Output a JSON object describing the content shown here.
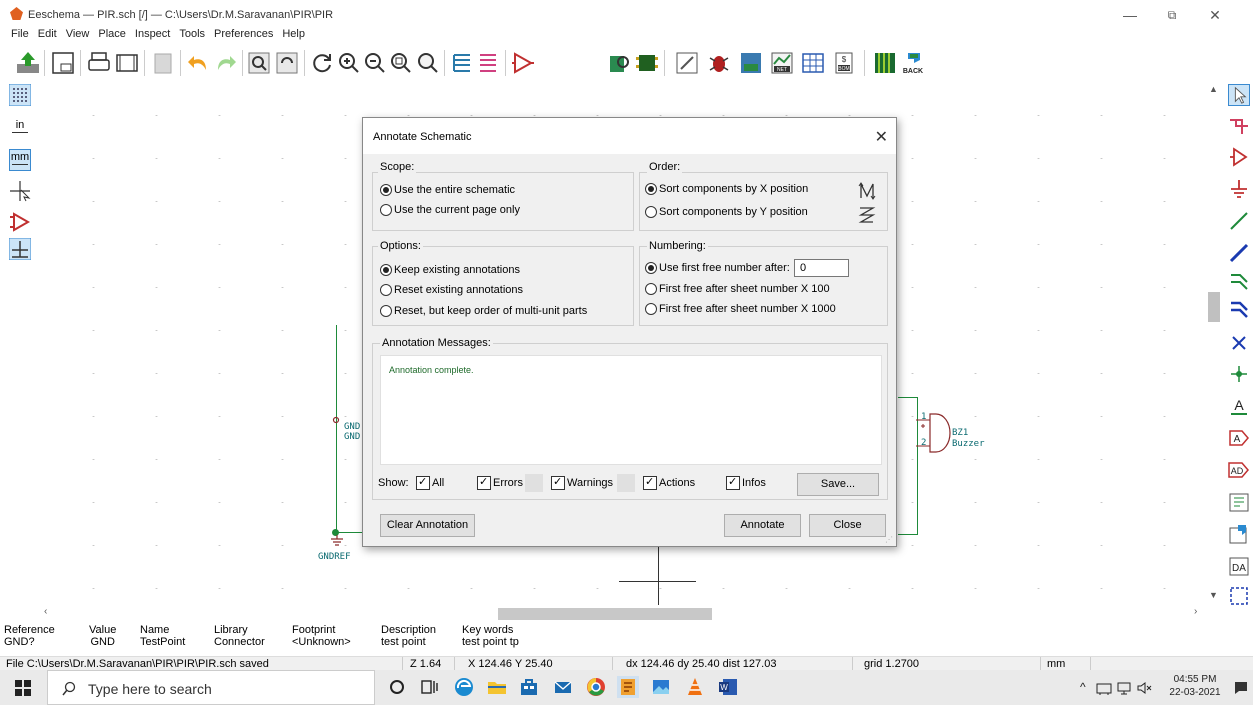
{
  "window": {
    "title": "Eeschema — PIR.sch [/] — C:\\Users\\Dr.M.Saravanan\\PIR\\PIR",
    "minimize": "—",
    "restore": "⧉",
    "close": "✕"
  },
  "menu": [
    "File",
    "Edit",
    "View",
    "Place",
    "Inspect",
    "Tools",
    "Preferences",
    "Help"
  ],
  "toolbar": {
    "back_label": "BACK",
    "net_label": "NET",
    "bom_label": "BOM"
  },
  "left_toolbar": {
    "units_in": "in",
    "units_mm": "mm"
  },
  "schematic": {
    "gnd_label_1": "GND",
    "gnd_label_2": "GND",
    "gndref_label": "GNDREF",
    "buzzer_ref": "BZ1",
    "buzzer_value": "Buzzer",
    "pin1": "1",
    "pin2": "2"
  },
  "dialog": {
    "title": "Annotate Schematic",
    "scope": {
      "label": "Scope:",
      "options": [
        "Use the entire schematic",
        "Use the current page only"
      ],
      "selected": 0
    },
    "order": {
      "label": "Order:",
      "options": [
        "Sort components by X position",
        "Sort components by Y position"
      ],
      "selected": 0
    },
    "options": {
      "label": "Options:",
      "options": [
        "Keep existing annotations",
        "Reset existing annotations",
        "Reset, but keep order of multi-unit parts"
      ],
      "selected": 0
    },
    "numbering": {
      "label": "Numbering:",
      "options": [
        "Use first free number after:",
        "First free after sheet number X 100",
        "First free after sheet number X 1000"
      ],
      "selected": 0,
      "first_free_value": "0"
    },
    "messages": {
      "label": "Annotation Messages:",
      "text": "Annotation complete."
    },
    "show": {
      "label": "Show:",
      "filters": [
        "All",
        "Errors",
        "Warnings",
        "Actions",
        "Infos"
      ]
    },
    "save_button": "Save...",
    "clear_button": "Clear Annotation",
    "annotate_button": "Annotate",
    "close_button": "Close"
  },
  "message_panel": [
    {
      "header": "Reference",
      "value": "GND?"
    },
    {
      "header": "Value",
      "value": "GND"
    },
    {
      "header": "Name",
      "value": "TestPoint"
    },
    {
      "header": "Library",
      "value": "Connector"
    },
    {
      "header": "Footprint",
      "value": "<Unknown>"
    },
    {
      "header": "Description",
      "value": "test point"
    },
    {
      "header": "Key words",
      "value": "test point tp"
    }
  ],
  "status": {
    "file_msg": "File C:\\Users\\Dr.M.Saravanan\\PIR\\PIR\\PIR.sch saved",
    "zoom": "Z 1.64",
    "coords": "X 124.46  Y 25.40",
    "delta": "dx 124.46  dy 25.40  dist 127.03",
    "grid": "grid 1.2700",
    "units": "mm"
  },
  "taskbar": {
    "search_placeholder": "Type here to search",
    "time": "04:55 PM",
    "date": "22-03-2021"
  }
}
